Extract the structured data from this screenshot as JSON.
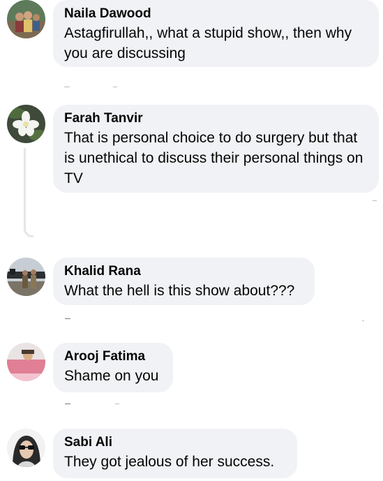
{
  "comments": [
    {
      "author": "Naila Dawood",
      "text": "Astagfirullah,, what a stupid show,, then why you are discussing"
    },
    {
      "author": "Farah Tanvir",
      "text": "That is personal choice to do surgery but that is unethical to discuss their personal things on TV"
    },
    {
      "author": "Khalid Rana",
      "text": "What the hell is this show about???"
    },
    {
      "author": "Arooj Fatima",
      "text": "Shame on you"
    },
    {
      "author": "Sabi Ali",
      "text": "They got jealous of her success."
    }
  ]
}
